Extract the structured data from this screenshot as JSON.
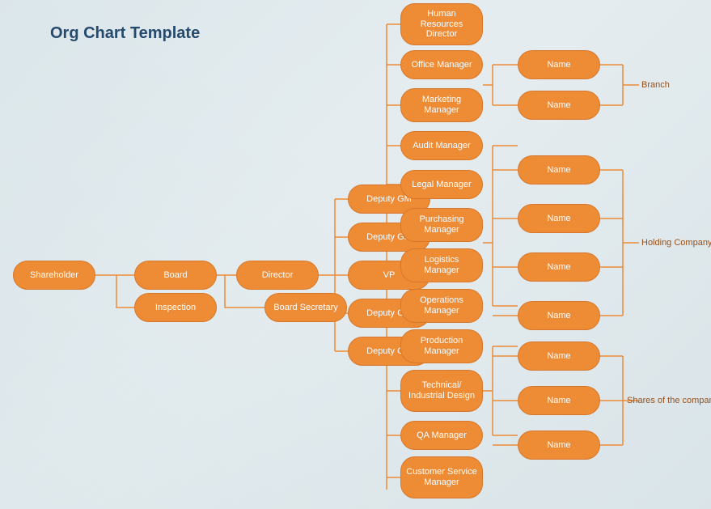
{
  "title": "Org Chart Template",
  "colors": {
    "node": "#ee8b35",
    "nodeBorder": "#d6782c",
    "nodeText": "#ffffff",
    "title": "#264a6e",
    "label": "#9a4f16"
  },
  "chart_data": {
    "type": "orgchart",
    "orientation": "left-to-right",
    "nodes": [
      {
        "id": "shareholder",
        "label": "Shareholder"
      },
      {
        "id": "board",
        "label": "Board",
        "parent": "shareholder"
      },
      {
        "id": "inspection",
        "label": "Inspection",
        "parent": "board",
        "assistant": true
      },
      {
        "id": "director",
        "label": "Director",
        "parent": "board"
      },
      {
        "id": "board_secretary",
        "label": "Board Secretary",
        "parent": "director",
        "assistant": true
      },
      {
        "id": "deputy_gm_1",
        "label": "Deputy GM",
        "parent": "director"
      },
      {
        "id": "deputy_gm_2",
        "label": "Deputy GM",
        "parent": "director"
      },
      {
        "id": "vp",
        "label": "VP",
        "parent": "director"
      },
      {
        "id": "deputy_gm_3",
        "label": "Deputy GM",
        "parent": "director"
      },
      {
        "id": "deputy_gm_4",
        "label": "Deputy GM",
        "parent": "director"
      },
      {
        "id": "hr_director",
        "label": "Human Resources Director",
        "parent": "vp"
      },
      {
        "id": "office_manager",
        "label": "Office Manager",
        "parent": "vp"
      },
      {
        "id": "marketing_manager",
        "label": "Marketing Manager",
        "parent": "vp"
      },
      {
        "id": "audit_manager",
        "label": "Audit Manager",
        "parent": "vp"
      },
      {
        "id": "legal_manager",
        "label": "Legal Manager",
        "parent": "vp"
      },
      {
        "id": "purchasing_manager",
        "label": "Purchasing Manager",
        "parent": "vp"
      },
      {
        "id": "logistics_manager",
        "label": "Logistics Manager",
        "parent": "vp"
      },
      {
        "id": "operations_manager",
        "label": "Operations Manager",
        "parent": "vp"
      },
      {
        "id": "production_manager",
        "label": "Production Manager",
        "parent": "vp"
      },
      {
        "id": "tech_design",
        "label": "Technical/ Industrial Design",
        "parent": "vp"
      },
      {
        "id": "qa_manager",
        "label": "QA Manager",
        "parent": "vp"
      },
      {
        "id": "cs_manager",
        "label": "Customer Service Manager",
        "parent": "vp"
      }
    ],
    "groups": [
      {
        "id": "branch",
        "label": "Branch",
        "members": [
          "name_b1",
          "name_b2"
        ],
        "linked_to": [
          "office_manager",
          "marketing_manager"
        ]
      },
      {
        "id": "holding",
        "label": "Holding Company",
        "members": [
          "name_h1",
          "name_h2",
          "name_h3",
          "name_h4"
        ],
        "linked_to": [
          "audit_manager",
          "legal_manager",
          "purchasing_manager",
          "logistics_manager",
          "operations_manager"
        ]
      },
      {
        "id": "shares",
        "label": "Shares of the company",
        "members": [
          "name_s1",
          "name_s2",
          "name_s3"
        ],
        "linked_to": [
          "production_manager",
          "tech_design",
          "qa_manager"
        ]
      }
    ],
    "name_nodes": [
      {
        "id": "name_b1",
        "label": "Name"
      },
      {
        "id": "name_b2",
        "label": "Name"
      },
      {
        "id": "name_h1",
        "label": "Name"
      },
      {
        "id": "name_h2",
        "label": "Name"
      },
      {
        "id": "name_h3",
        "label": "Name"
      },
      {
        "id": "name_h4",
        "label": "Name"
      },
      {
        "id": "name_s1",
        "label": "Name"
      },
      {
        "id": "name_s2",
        "label": "Name"
      },
      {
        "id": "name_s3",
        "label": "Name"
      }
    ]
  },
  "nodes": {
    "shareholder": "Shareholder",
    "board": "Board",
    "inspection": "Inspection",
    "director": "Director",
    "board_secretary": "Board Secretary",
    "deputy_gm_1": "Deputy GM",
    "deputy_gm_2": "Deputy GM",
    "vp": "VP",
    "deputy_gm_3": "Deputy GM",
    "deputy_gm_4": "Deputy GM",
    "hr_director": "Human Resources Director",
    "office_manager": "Office Manager",
    "marketing_manager": "Marketing Manager",
    "audit_manager": "Audit Manager",
    "legal_manager": "Legal Manager",
    "purchasing_manager": "Purchasing Manager",
    "logistics_manager": "Logistics Manager",
    "operations_manager": "Operations Manager",
    "production_manager": "Production Manager",
    "tech_design": "Technical/ Industrial Design",
    "qa_manager": "QA Manager",
    "cs_manager": "Customer Service Manager",
    "name_b1": "Name",
    "name_b2": "Name",
    "name_h1": "Name",
    "name_h2": "Name",
    "name_h3": "Name",
    "name_h4": "Name",
    "name_s1": "Name",
    "name_s2": "Name",
    "name_s3": "Name"
  },
  "labels": {
    "branch": "Branch",
    "holding": "Holding Company",
    "shares": "Shares of the company"
  }
}
